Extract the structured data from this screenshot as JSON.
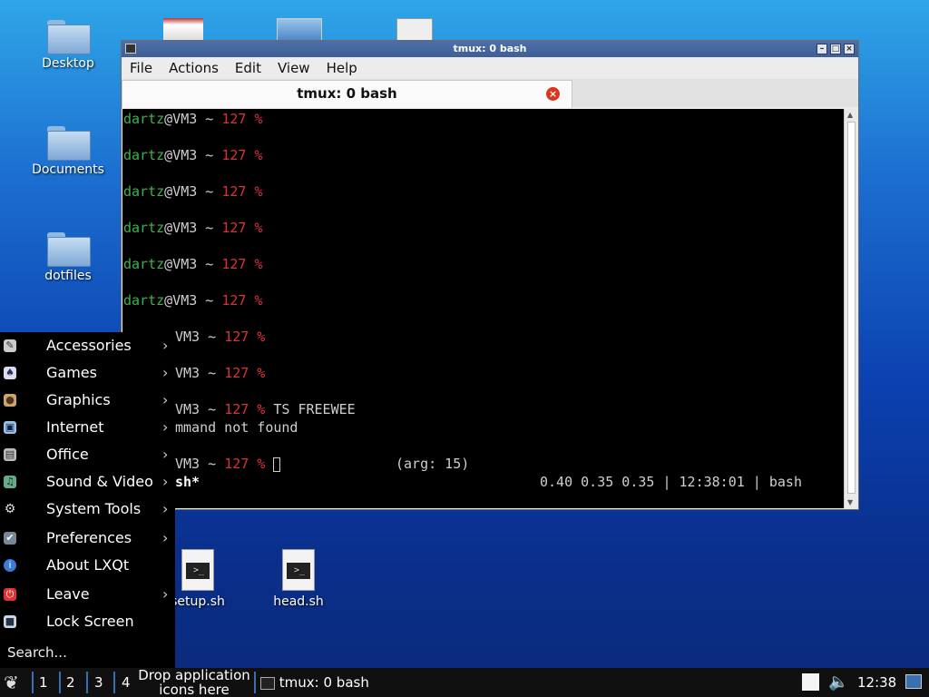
{
  "desktop": {
    "icons": [
      {
        "label": "Desktop"
      },
      {
        "label": "Documents"
      },
      {
        "label": "dotfiles"
      },
      {
        "label": "setup.sh"
      },
      {
        "label": "head.sh"
      }
    ]
  },
  "window": {
    "title": "tmux: 0 bash",
    "menu": [
      "File",
      "Actions",
      "Edit",
      "View",
      "Help"
    ],
    "tab_label": "tmux: 0 bash",
    "terminal": {
      "user": "dartz",
      "host": "@VM3 ~ ",
      "code": "127 %",
      "hidden_prefix": "VM3 ~ ",
      "command": " TS FREEWEE",
      "error": "mmand not found",
      "arg": "(arg: 15)",
      "status_left": "sh*",
      "status_right": "0.40 0.35 0.35 | 12:38:01 | bash"
    }
  },
  "start_menu": {
    "items": [
      {
        "label": "Accessories",
        "icon": "accessories-icon",
        "submenu": true
      },
      {
        "label": "Games",
        "icon": "games-icon",
        "submenu": true
      },
      {
        "label": "Graphics",
        "icon": "graphics-icon",
        "submenu": true
      },
      {
        "label": "Internet",
        "icon": "internet-icon",
        "submenu": true
      },
      {
        "label": "Office",
        "icon": "office-icon",
        "submenu": true
      },
      {
        "label": "Sound & Video",
        "icon": "sound-video-icon",
        "submenu": true
      },
      {
        "label": "System Tools",
        "icon": "system-tools-icon",
        "submenu": true
      },
      {
        "label": "Preferences",
        "icon": "preferences-icon",
        "submenu": true
      },
      {
        "label": "About LXQt",
        "icon": "info-icon",
        "submenu": false
      },
      {
        "label": "Leave",
        "icon": "power-icon",
        "submenu": true
      },
      {
        "label": "Lock Screen",
        "icon": "lock-icon",
        "submenu": false
      }
    ],
    "search_placeholder": "Search..."
  },
  "taskbar": {
    "workspaces": [
      "1",
      "2",
      "3",
      "4"
    ],
    "drop_line1": "Drop application",
    "drop_line2": "icons here",
    "task_label": "tmux: 0 bash",
    "clock": "12:38"
  },
  "colors": {
    "prompt_user": "#3fb24a",
    "prompt_code": "#d8333a",
    "titlebar": "#4d6fa8"
  }
}
